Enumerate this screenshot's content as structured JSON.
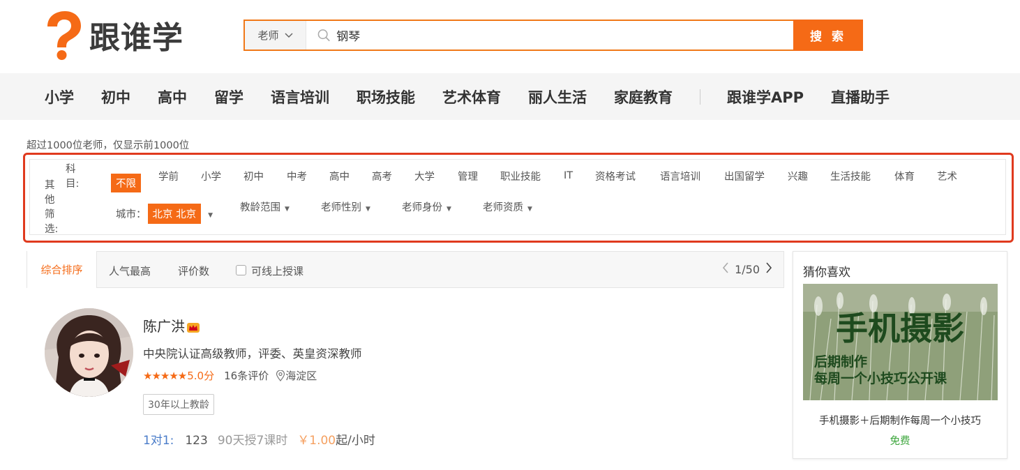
{
  "logo": {
    "text": "跟谁学"
  },
  "search": {
    "type_label": "老师",
    "query": "钢琴",
    "button_label": "搜 索"
  },
  "nav": {
    "items": [
      "小学",
      "初中",
      "高中",
      "留学",
      "语言培训",
      "职场技能",
      "艺术体育",
      "丽人生活",
      "家庭教育"
    ],
    "extra": [
      "跟谁学APP",
      "直播助手"
    ]
  },
  "notice": "超过1000位老师，仅显示前1000位",
  "filter": {
    "subject_label": "科目:",
    "subjects": [
      "不限",
      "学前",
      "小学",
      "初中",
      "中考",
      "高中",
      "高考",
      "大学",
      "管理",
      "职业技能",
      "IT",
      "资格考试",
      "语言培训",
      "出国留学",
      "兴趣",
      "生活技能",
      "体育",
      "艺术"
    ],
    "active_subject": "不限",
    "other_label": "其他筛选:",
    "city_label": "城市：",
    "city_value": "北京 北京",
    "dropdowns": [
      "教龄范围",
      "老师性别",
      "老师身份",
      "老师资质"
    ]
  },
  "sort": {
    "active": "综合排序",
    "items": [
      "人气最高",
      "评价数"
    ],
    "online_label": "可线上授课",
    "page": "1/50"
  },
  "teacher": {
    "name": "陈广洪",
    "description": "中央院认证高级教师，评委、英皇资深教师",
    "stars": "★★★★★",
    "score": "5.0分",
    "reviews": "16条评价",
    "location": "海淀区",
    "tag": "30年以上教龄",
    "one_on_one": "1对1:",
    "count": "123",
    "stats": "90天授7课时",
    "price": "￥1.00",
    "price_unit": "起/小时"
  },
  "sidebar": {
    "title": "猜你喜欢",
    "image_title": "手机摄影",
    "image_line1": "后期制作",
    "image_line2": "每周一个小技巧公开课",
    "caption": "手机摄影＋后期制作每周一个小技巧",
    "price": "免费"
  },
  "colors": {
    "accent": "#f56a16",
    "highlight_border": "#e03a1e",
    "link_blue": "#4a7cc9",
    "free_green": "#3aa53a"
  }
}
